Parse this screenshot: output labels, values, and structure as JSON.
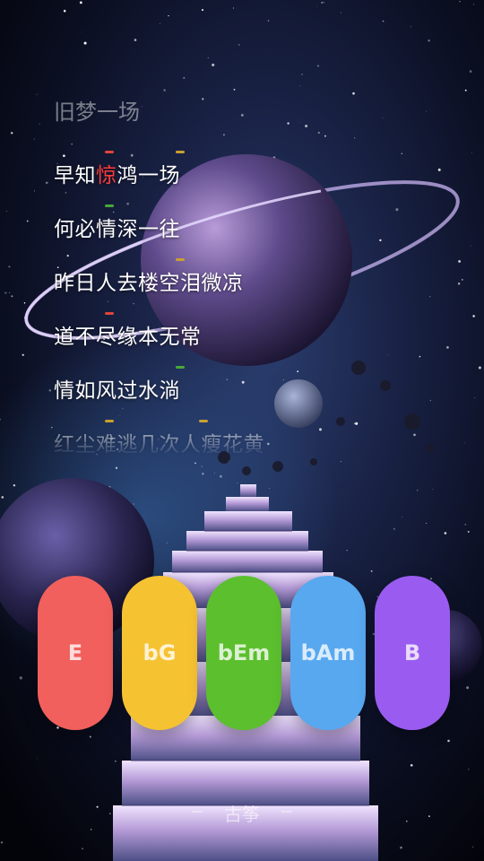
{
  "song": {
    "title": "旧梦一场"
  },
  "lyrics": [
    {
      "pre": "早知",
      "highlight": "惊",
      "post": "鸿一场"
    },
    {
      "pre": "何必情深一往",
      "highlight": "",
      "post": ""
    },
    {
      "pre": "昨日人去楼空泪微凉",
      "highlight": "",
      "post": ""
    },
    {
      "pre": "道不尽缘本无常",
      "highlight": "",
      "post": ""
    },
    {
      "pre": "情如风过水淌",
      "highlight": "",
      "post": ""
    },
    {
      "pre": "红尘难逃几次人瘦花黄",
      "highlight": "",
      "post": ""
    }
  ],
  "chords": [
    {
      "label": "E",
      "color": "#f1605c"
    },
    {
      "label": "bG",
      "color": "#f5c232"
    },
    {
      "label": "bEm",
      "color": "#5cbf2e"
    },
    {
      "label": "bAm",
      "color": "#58a8f0"
    },
    {
      "label": "B",
      "color": "#9a5cf0"
    }
  ],
  "instrument": {
    "label": "古筝"
  },
  "colors": {
    "highlight": "#ff3b3b",
    "marker_red": "#e0453a",
    "marker_yellow": "#c9a030",
    "marker_green": "#4aa83a"
  }
}
